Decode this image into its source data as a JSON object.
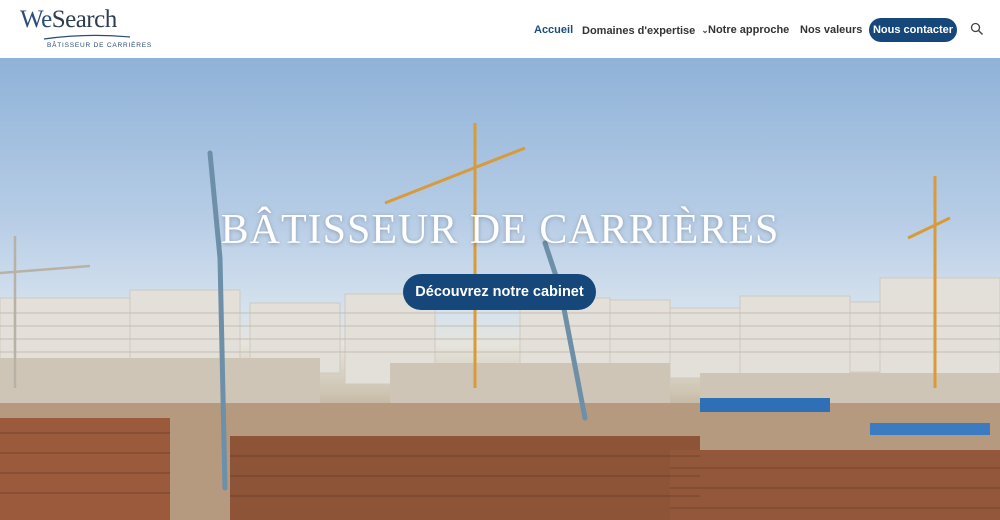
{
  "brand": {
    "name_prefix": "We",
    "name_suffix": "Search",
    "tagline": "BÂTISSEUR DE CARRIÈRES"
  },
  "nav": {
    "items": [
      {
        "label": "Accueil",
        "active": true
      },
      {
        "label": "Domaines d'expertise",
        "has_dropdown": true
      },
      {
        "label": "Notre approche"
      },
      {
        "label": "Nos valeurs"
      }
    ],
    "cta_label": "Nous contacter",
    "search_icon": "search-icon"
  },
  "hero": {
    "title": "BÂTISSEUR DE CARRIÈRES",
    "button_label": "Découvrez notre cabinet",
    "background": "construction-site-photo"
  },
  "colors": {
    "brand_blue": "#16477a",
    "active_nav": "#1f4d7a",
    "text": "#333333"
  }
}
